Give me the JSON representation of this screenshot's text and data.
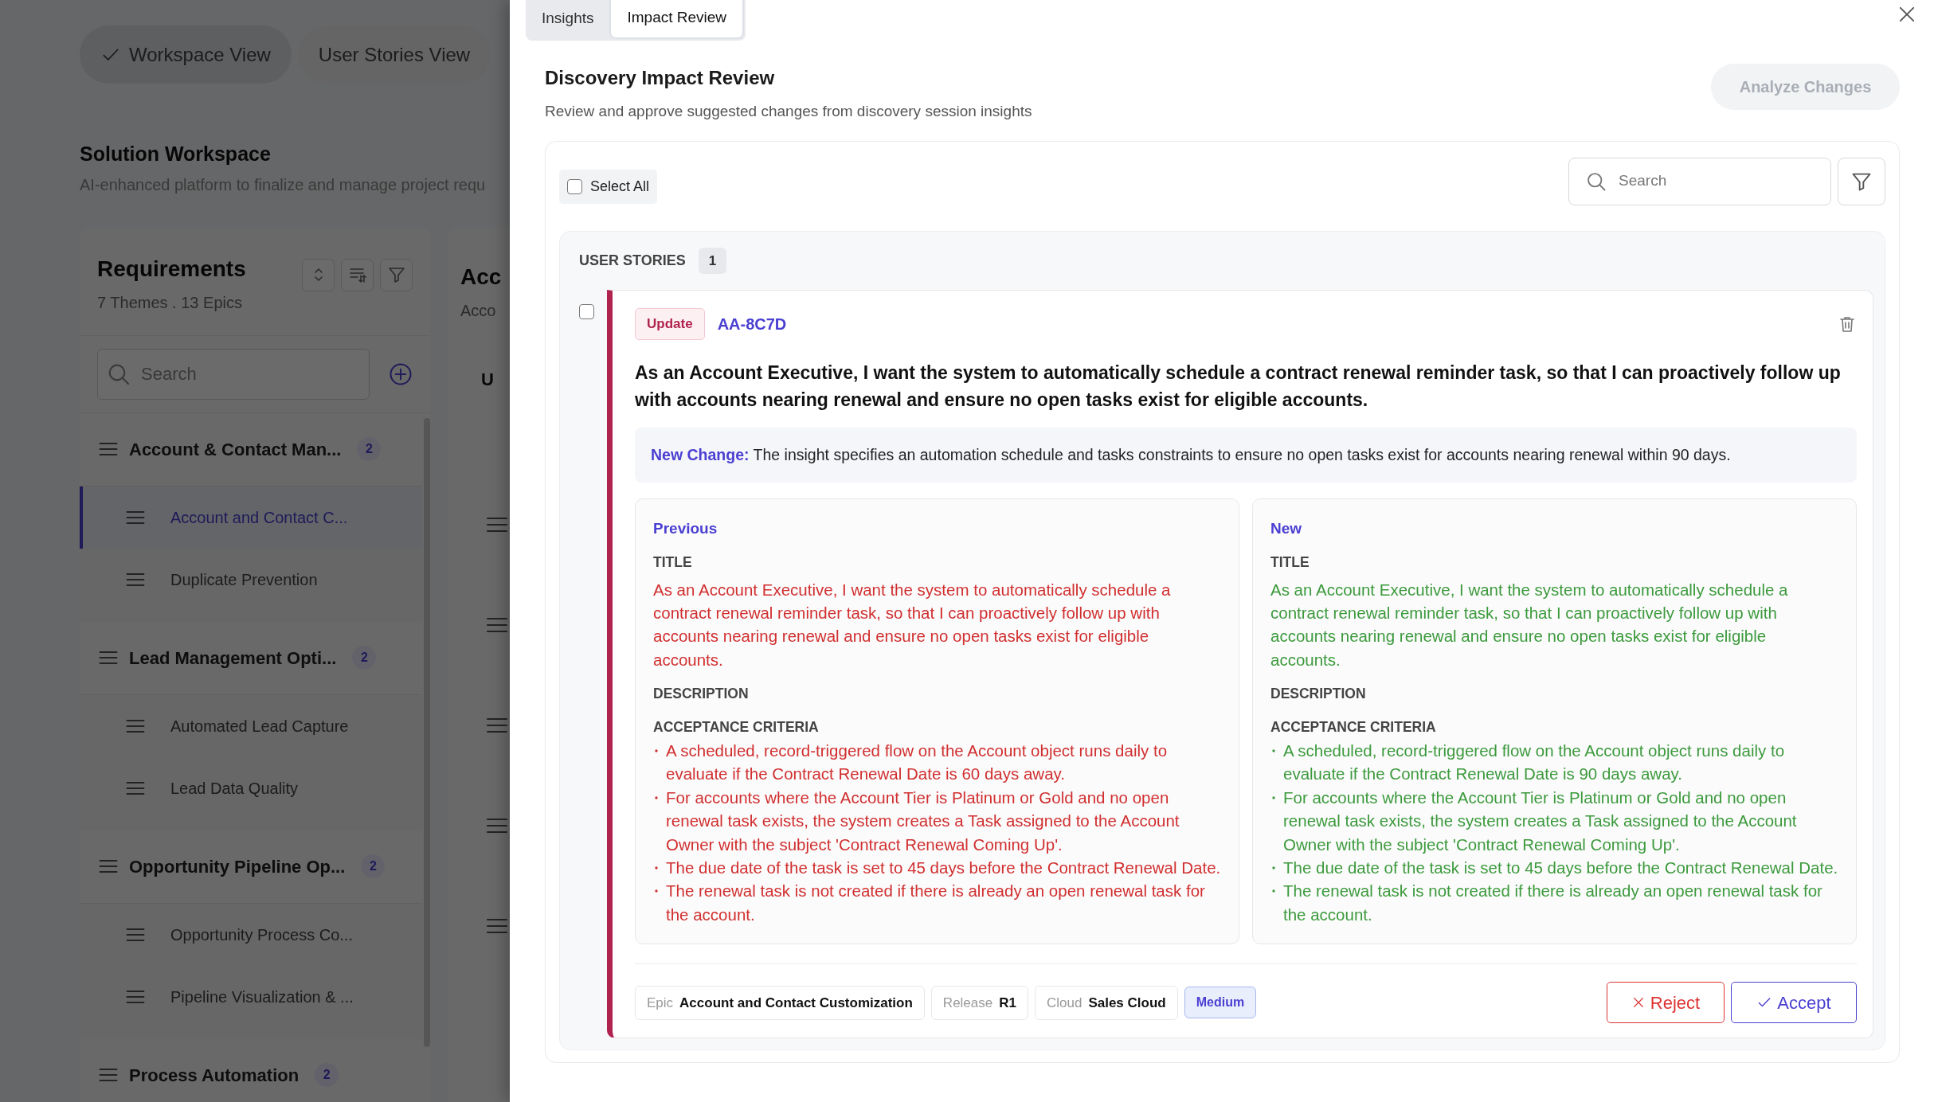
{
  "background": {
    "view_tabs": [
      {
        "label": "Workspace View",
        "selected": true
      },
      {
        "label": "User Stories View",
        "selected": false
      }
    ],
    "title": "Solution Workspace",
    "subtitle": "AI-enhanced platform to finalize and manage project requ",
    "requirements": {
      "title": "Requirements",
      "summary": "7 Themes . 13 Epics",
      "search": {
        "placeholder": "Search"
      },
      "themes": [
        {
          "label": "Account & Contact Man...",
          "count": "2",
          "children": [
            {
              "label": "Account and Contact C...",
              "selected": true
            },
            {
              "label": "Duplicate Prevention",
              "selected": false
            }
          ]
        },
        {
          "label": "Lead Management Opti...",
          "count": "2",
          "children": [
            {
              "label": "Automated Lead Capture",
              "selected": false
            },
            {
              "label": "Lead Data Quality",
              "selected": false
            }
          ]
        },
        {
          "label": "Opportunity Pipeline Op...",
          "count": "2",
          "children": [
            {
              "label": "Opportunity Process Co...",
              "selected": false
            },
            {
              "label": "Pipeline Visualization & ...",
              "selected": false
            }
          ]
        },
        {
          "label": "Process Automation",
          "count": "2"
        }
      ]
    },
    "detail_column": {
      "title": "Acc",
      "subtitle": "Acco",
      "header": "U"
    }
  },
  "drawer": {
    "tabs": [
      {
        "label": "Insights",
        "selected": false
      },
      {
        "label": "Impact Review",
        "selected": true
      }
    ],
    "title": "Discovery Impact Review",
    "subtitle": "Review and approve suggested changes from discovery session insights",
    "analyze_button": {
      "label": "Analyze Changes",
      "disabled": true
    },
    "select_all": {
      "label": "Select All",
      "checked": false
    },
    "search": {
      "placeholder": "Search"
    },
    "groups": [
      {
        "label": "USER STORIES",
        "count": "1",
        "items": [
          {
            "selected": false,
            "change_type": "Update",
            "id": "AA-8C7D",
            "text": "As an Account Executive, I want the system to automatically schedule a contract renewal reminder task, so that I can proactively follow up with accounts nearing renewal and ensure no open tasks exist for eligible accounts.",
            "change_label": "New Change:",
            "change_text": "The insight specifies an automation schedule and tasks constraints to ensure no open tasks exist for accounts nearing renewal within 90 days.",
            "versions": [
              {
                "kind": "previous",
                "heading": "Previous",
                "title_label": "TITLE",
                "title": "As an Account Executive, I want the system to automatically schedule a contract renewal reminder task, so that I can proactively follow up with accounts nearing renewal and ensure no open tasks exist for eligible accounts.",
                "description_label": "DESCRIPTION",
                "criteria_label": "ACCEPTANCE CRITERIA",
                "criteria": [
                  "A scheduled, record-triggered flow on the Account object runs daily to evaluate if the Contract Renewal Date is 60 days away.",
                  "For accounts where the Account Tier is Platinum or Gold and no open renewal task exists, the system creates a Task assigned to the Account Owner with the subject 'Contract Renewal Coming Up'.",
                  "The due date of the task is set to 45 days before the Contract Renewal Date.",
                  "The renewal task is not created if there is already an open renewal task for the account."
                ]
              },
              {
                "kind": "new",
                "heading": "New",
                "title_label": "TITLE",
                "title": "As an Account Executive, I want the system to automatically schedule a contract renewal reminder task, so that I can proactively follow up with accounts nearing renewal and ensure no open tasks exist for eligible accounts.",
                "description_label": "DESCRIPTION",
                "criteria_label": "ACCEPTANCE CRITERIA",
                "criteria": [
                  "A scheduled, record-triggered flow on the Account object runs daily to evaluate if the Contract Renewal Date is 90 days away.",
                  "For accounts where the Account Tier is Platinum or Gold and no open renewal task exists, the system creates a Task assigned to the Account Owner with the subject 'Contract Renewal Coming Up'.",
                  "The due date of the task is set to 45 days before the Contract Renewal Date.",
                  "The renewal task is not created if there is already an open renewal task for the account."
                ]
              }
            ],
            "meta": [
              {
                "label": "Epic",
                "value": "Account and Contact Customization"
              },
              {
                "label": "Release",
                "value": "R1"
              },
              {
                "label": "Cloud",
                "value": "Sales Cloud"
              }
            ],
            "priority": "Medium",
            "reject_label": "Reject",
            "accept_label": "Accept"
          }
        ]
      }
    ]
  }
}
